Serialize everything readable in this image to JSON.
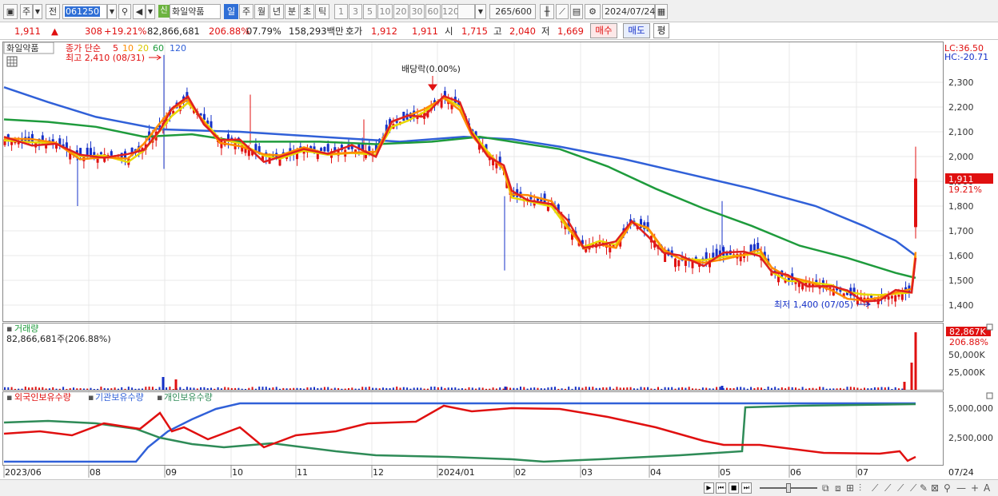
{
  "toolbar": {
    "period_main": "주",
    "price_type": "전",
    "stock_code": "061250",
    "badge_new": "신",
    "stock_name": "화일약품",
    "periods": [
      {
        "label": "일",
        "selected": true
      },
      {
        "label": "주",
        "selected": false
      },
      {
        "label": "월",
        "selected": false
      },
      {
        "label": "년",
        "selected": false
      },
      {
        "label": "분",
        "selected": false
      },
      {
        "label": "초",
        "selected": false
      },
      {
        "label": "틱",
        "selected": false
      }
    ],
    "intervals": [
      "1",
      "3",
      "5",
      "10",
      "20",
      "30",
      "60",
      "120"
    ],
    "bar_count": "265",
    "bar_total": "/600",
    "date": "2024/07/24"
  },
  "quote": {
    "price": "1,911",
    "arrow": "▲",
    "change": "308",
    "change_pct": "+19.21%",
    "volume": "82,866,681",
    "volume_ratio": "206.88%",
    "turnover": "07.79%",
    "amount": "158,293백만",
    "bid_label": "호가",
    "bid1": "1,912",
    "bid2": "1,911",
    "open_label": "시",
    "open": "1,715",
    "high_label": "고",
    "high": "2,040",
    "low_label": "저",
    "low": "1,669",
    "buy": "매수",
    "sell": "매도",
    "avg": "평"
  },
  "price_panel": {
    "title": "화일약품",
    "legend_prefix": "종가 단순",
    "ma_labels": [
      "5",
      "10",
      "20",
      "60",
      "120"
    ],
    "ma_colors": [
      "#e02020",
      "#ff8c00",
      "#e8d800",
      "#1e9b3c",
      "#3060d8"
    ],
    "high_annotation": "최고 2,410 (08/31)",
    "low_annotation": "최저 1,400 (07/05)",
    "dividend_annotation": "배당락(0.00%)",
    "lc": "LC:36.50",
    "hc": "HC:-20.71",
    "current_price_tag": "1,911",
    "current_pct_tag": "19.21%",
    "y_ticks": [
      "2,300",
      "2,200",
      "2,100",
      "2,000",
      "1,900",
      "1,800",
      "1,700",
      "1,600",
      "1,500",
      "1,400"
    ]
  },
  "volume_panel": {
    "title": "거래량",
    "value_label": "82,866,681주(206.88%)",
    "tag_value": "82,867K",
    "tag_pct": "206.88%",
    "y_ticks": [
      "75,000K",
      "50,000K",
      "25,000K"
    ]
  },
  "holdings_panel": {
    "legends": [
      "외국인보유수량",
      "기관보유수량",
      "개인보유수량"
    ],
    "legend_colors": [
      "#e01010",
      "#3060d8",
      "#2e8b57"
    ],
    "y_ticks": [
      "5,000,000",
      "2,500,000"
    ]
  },
  "x_axis": {
    "labels": [
      "2023/06",
      "08",
      "09",
      "10",
      "11",
      "12",
      "2024/01",
      "02",
      "03",
      "04",
      "05",
      "06",
      "07"
    ],
    "right_label": "07/24"
  },
  "colors": {
    "up": "#e01010",
    "down": "#1530c8",
    "grid": "#e6e6e6"
  }
}
